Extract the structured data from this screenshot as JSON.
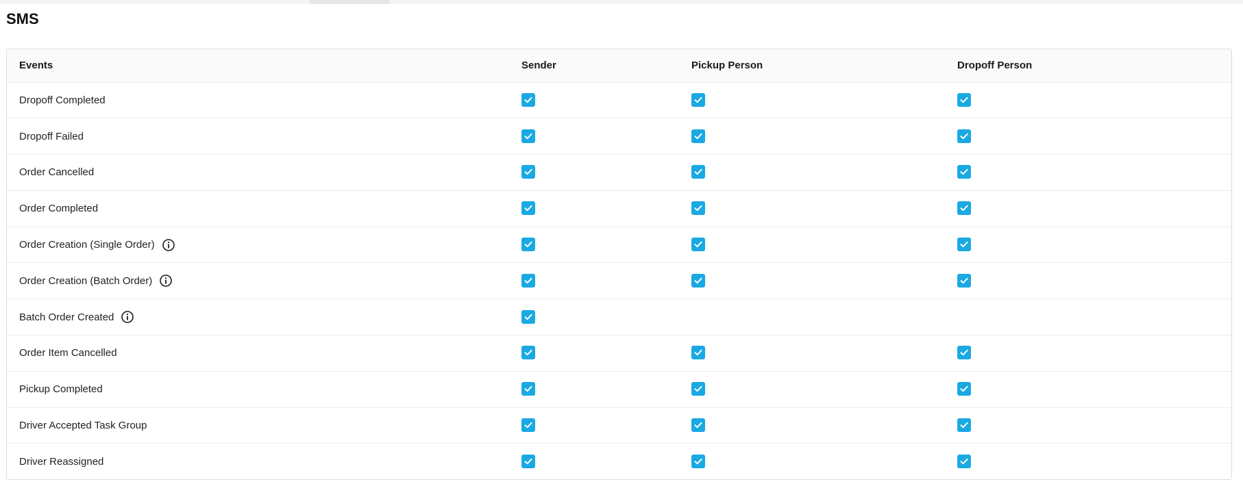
{
  "section": {
    "title": "SMS"
  },
  "table": {
    "headers": {
      "events": "Events",
      "sender": "Sender",
      "pickup": "Pickup Person",
      "dropoff": "Dropoff Person"
    },
    "rows": [
      {
        "event": "Dropoff Completed",
        "info": false,
        "sender": true,
        "pickup": true,
        "dropoff": true
      },
      {
        "event": "Dropoff Failed",
        "info": false,
        "sender": true,
        "pickup": true,
        "dropoff": true
      },
      {
        "event": "Order Cancelled",
        "info": false,
        "sender": true,
        "pickup": true,
        "dropoff": true
      },
      {
        "event": "Order Completed",
        "info": false,
        "sender": true,
        "pickup": true,
        "dropoff": true
      },
      {
        "event": "Order Creation (Single Order)",
        "info": true,
        "sender": true,
        "pickup": true,
        "dropoff": true
      },
      {
        "event": "Order Creation (Batch Order)",
        "info": true,
        "sender": true,
        "pickup": true,
        "dropoff": true
      },
      {
        "event": "Batch Order Created",
        "info": true,
        "sender": true,
        "pickup": null,
        "dropoff": null
      },
      {
        "event": "Order Item Cancelled",
        "info": false,
        "sender": true,
        "pickup": true,
        "dropoff": true
      },
      {
        "event": "Pickup Completed",
        "info": false,
        "sender": true,
        "pickup": true,
        "dropoff": true
      },
      {
        "event": "Driver Accepted Task Group",
        "info": false,
        "sender": true,
        "pickup": true,
        "dropoff": true
      },
      {
        "event": "Driver Reassigned",
        "info": false,
        "sender": true,
        "pickup": true,
        "dropoff": true
      }
    ]
  },
  "icons": {
    "checkbox": "checkmark-icon",
    "info": "info-circle-icon"
  },
  "colors": {
    "checkbox": "#1aa9e3"
  }
}
